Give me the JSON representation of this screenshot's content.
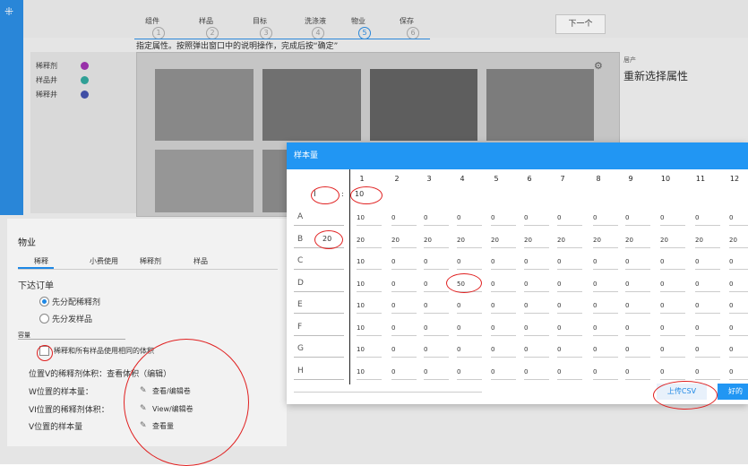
{
  "steps": [
    {
      "label": "组件",
      "num": "1"
    },
    {
      "label": "样品",
      "num": "2"
    },
    {
      "label": "目标",
      "num": "3"
    },
    {
      "label": "洗涤液",
      "num": "4"
    },
    {
      "label": "物业",
      "num": "5"
    },
    {
      "label": "保存",
      "num": "6"
    }
  ],
  "next_label": "下一个",
  "instruction": "指定属性。按照弹出窗口中的说明操作，完成后按“确定”",
  "legend": [
    {
      "label": "稀释剂",
      "color": "#9c27b0"
    },
    {
      "label": "样品井",
      "color": "#26a69a"
    },
    {
      "label": "稀释井",
      "color": "#3949ab"
    }
  ],
  "right_panel": {
    "small": "居产",
    "title": "重新选择属性"
  },
  "materials": {
    "title": "物业",
    "tabs": [
      "稀释",
      "小费使用",
      "稀释剂",
      "样品"
    ],
    "order_heading": "下达订单",
    "radio1": "先分配稀释剂",
    "radio2": "先分发样品",
    "volume_heading": "容量",
    "checkbox_label": "稀释和所有样品使用相同的体积",
    "line1": "位置V的稀释剂体积：查看体积（编辑）",
    "line2_label": "W位置的样本量：",
    "line2_action": "查看/编辑卷",
    "line3_label": "VI位置的稀释剂体积：",
    "line3_action": "View/编辑卷",
    "line4_label": "V位置的样本量",
    "line4_action": "查看量"
  },
  "dialog": {
    "title": "样本量",
    "columns": [
      "1",
      "2",
      "3",
      "4",
      "5",
      "6",
      "7",
      "8",
      "9",
      "10",
      "11",
      "12"
    ],
    "fill_input": "I",
    "fill_value": "10",
    "rows": [
      {
        "label": "A",
        "side": "",
        "values": [
          "10",
          "0",
          "0",
          "0",
          "0",
          "0",
          "0",
          "0",
          "0",
          "0",
          "0",
          "0"
        ]
      },
      {
        "label": "B",
        "side": "20",
        "values": [
          "20",
          "20",
          "20",
          "20",
          "20",
          "20",
          "20",
          "20",
          "20",
          "20",
          "20",
          "20"
        ]
      },
      {
        "label": "C",
        "side": "",
        "values": [
          "10",
          "0",
          "0",
          "0",
          "0",
          "0",
          "0",
          "0",
          "0",
          "0",
          "0",
          "0"
        ]
      },
      {
        "label": "D",
        "side": "",
        "values": [
          "10",
          "0",
          "0",
          "50",
          "0",
          "0",
          "0",
          "0",
          "0",
          "0",
          "0",
          "0"
        ]
      },
      {
        "label": "E",
        "side": "",
        "values": [
          "10",
          "0",
          "0",
          "0",
          "0",
          "0",
          "0",
          "0",
          "0",
          "0",
          "0",
          "0"
        ]
      },
      {
        "label": "F",
        "side": "",
        "values": [
          "10",
          "0",
          "0",
          "0",
          "0",
          "0",
          "0",
          "0",
          "0",
          "0",
          "0",
          "0"
        ]
      },
      {
        "label": "G",
        "side": "",
        "values": [
          "10",
          "0",
          "0",
          "0",
          "0",
          "0",
          "0",
          "0",
          "0",
          "0",
          "0",
          "0"
        ]
      },
      {
        "label": "H",
        "side": "",
        "values": [
          "10",
          "0",
          "0",
          "0",
          "0",
          "0",
          "0",
          "0",
          "0",
          "0",
          "0",
          "0"
        ]
      }
    ],
    "upload_label": "上传CSV",
    "ok_label": "好的"
  }
}
